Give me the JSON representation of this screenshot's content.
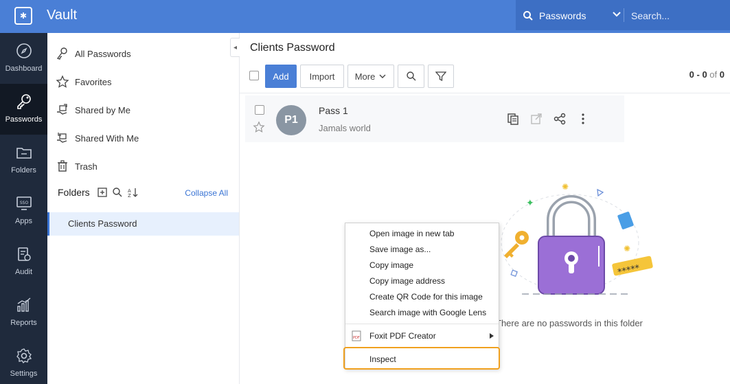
{
  "app": {
    "title": "Vault"
  },
  "search": {
    "scope": "Passwords",
    "placeholder": "Search..."
  },
  "leftnav": [
    {
      "label": "Dashboard",
      "icon": "compass-icon"
    },
    {
      "label": "Passwords",
      "icon": "key-icon",
      "active": true
    },
    {
      "label": "Folders",
      "icon": "folder-icon"
    },
    {
      "label": "Apps",
      "icon": "sso-icon"
    },
    {
      "label": "Audit",
      "icon": "audit-icon"
    },
    {
      "label": "Reports",
      "icon": "chart-icon"
    },
    {
      "label": "Settings",
      "icon": "gear-icon"
    }
  ],
  "sidebar": {
    "items": [
      {
        "label": "All Passwords",
        "icon": "keys-icon"
      },
      {
        "label": "Favorites",
        "icon": "star-icon"
      },
      {
        "label": "Shared by Me",
        "icon": "share-out-icon"
      },
      {
        "label": "Shared With Me",
        "icon": "share-in-icon"
      },
      {
        "label": "Trash",
        "icon": "trash-icon"
      }
    ],
    "folders_title": "Folders",
    "collapse_all": "Collapse All",
    "folder": "Clients Password"
  },
  "main": {
    "title": "Clients Password",
    "toolbar": {
      "add": "Add",
      "import": "Import",
      "more": "More"
    },
    "pager": {
      "range": "0 - 0",
      "of": "of",
      "total": "0"
    },
    "entry": {
      "avatar": "P1",
      "title": "Pass 1",
      "subtitle": "Jamals world"
    },
    "empty_text": "There are no passwords in this folder"
  },
  "context_menu": {
    "items": [
      "Open image in new tab",
      "Save image as...",
      "Copy image",
      "Copy image address",
      "Create QR Code for this image",
      "Search image with Google Lens"
    ],
    "foxit": "Foxit PDF Creator",
    "inspect": "Inspect"
  },
  "colors": {
    "brand": "#4a7fd6",
    "nav_bg": "#1f2a3c",
    "highlight": "#f0a01e",
    "lock": "#9b6fd6"
  },
  "illustration": {
    "password_mask": "*****"
  }
}
